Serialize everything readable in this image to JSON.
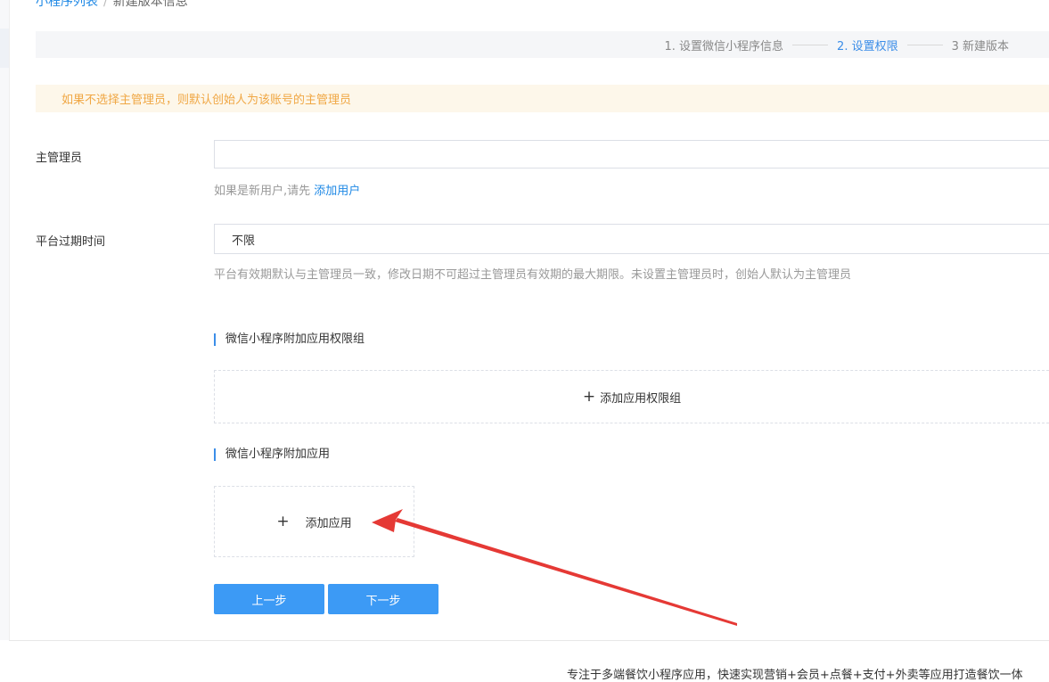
{
  "breadcrumb": {
    "first": "小程序列表",
    "separator": "/",
    "current": "新建版本信息"
  },
  "steps": [
    {
      "label": "1. 设置微信小程序信息",
      "active": false
    },
    {
      "label": "2. 设置权限",
      "active": true
    },
    {
      "label": "3 新建版本",
      "active": false
    }
  ],
  "notice": {
    "text": "如果不选择主管理员，则默认创始人为该账号的主管理员"
  },
  "form": {
    "admin": {
      "label": "主管理员",
      "value": "",
      "placeholder": "",
      "help_prefix": "如果是新用户,请先 ",
      "help_link": "添加用户"
    },
    "expiry": {
      "label": "平台过期时间",
      "selected": "不限",
      "help": "平台有效期默认与主管理员一致，修改日期不可超过主管理员有效期的最大期限。未设置主管理员时，创始人默认为主管理员"
    }
  },
  "permission_group": {
    "title": "微信小程序附加应用权限组",
    "add_label": "添加应用权限组"
  },
  "apps": {
    "title": "微信小程序附加应用",
    "add_label": "添加应用"
  },
  "buttons": {
    "prev": "上一步",
    "next": "下一步"
  },
  "footer": {
    "text": "专注于多端餐饮小程序应用，快速实现营销+会员+点餐+支付+外卖等应用打造餐饮一体"
  },
  "icons": {
    "plus": "plus-icon",
    "arrow": "annotation-arrow"
  },
  "colors": {
    "accent": "#3c8ee8",
    "button": "#3c9af5",
    "notice_text": "#f0a744",
    "notice_bg": "#fdf7ea",
    "annotation": "#e53935"
  }
}
